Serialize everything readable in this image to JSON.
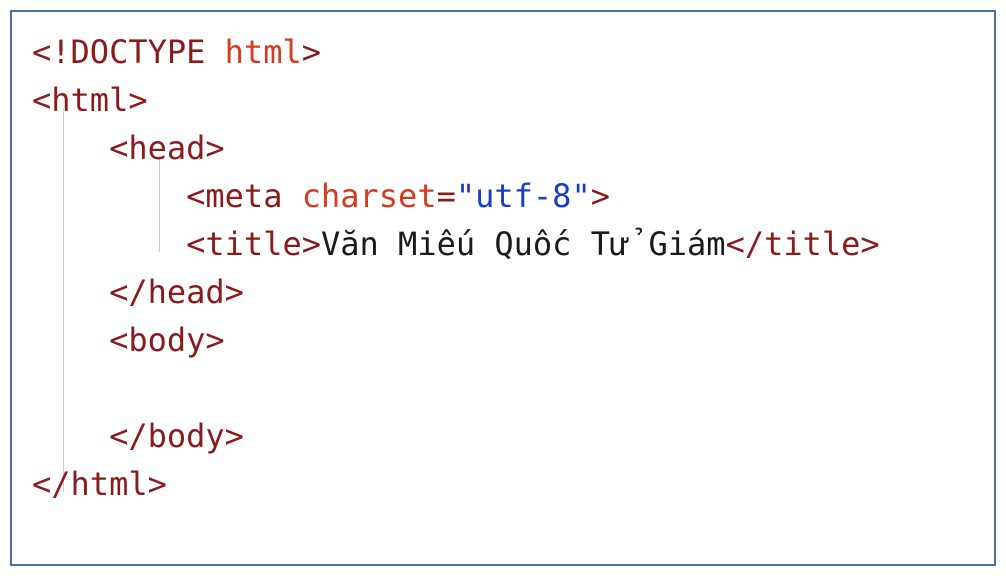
{
  "code": {
    "line1": {
      "p1": "<!",
      "kw": "DOCTYPE",
      "sp": " ",
      "kw2": "html",
      "p2": ">"
    },
    "line2": {
      "p1": "<",
      "tag": "html",
      "p2": ">"
    },
    "line3": {
      "indent": "    ",
      "p1": "<",
      "tag": "head",
      "p2": ">"
    },
    "line4": {
      "indent": "        ",
      "p1": "<",
      "tag": "meta",
      "sp": " ",
      "attr": "charset",
      "eq": "=",
      "val": "\"utf-8\"",
      "p2": ">"
    },
    "line5": {
      "indent": "        ",
      "p1": "<",
      "tag": "title",
      "p2": ">",
      "text": "Văn Miếu Quốc Tử Giám",
      "p3": "</",
      "tag2": "title",
      "p4": ">"
    },
    "line6": {
      "indent": "    ",
      "p1": "</",
      "tag": "head",
      "p2": ">"
    },
    "line7": {
      "indent": "    ",
      "p1": "<",
      "tag": "body",
      "p2": ">"
    },
    "line8": {
      "blank": " "
    },
    "line9": {
      "indent": "    ",
      "p1": "</",
      "tag": "body",
      "p2": ">"
    },
    "line10": {
      "p1": "</",
      "tag": "html",
      "p2": ">"
    }
  }
}
